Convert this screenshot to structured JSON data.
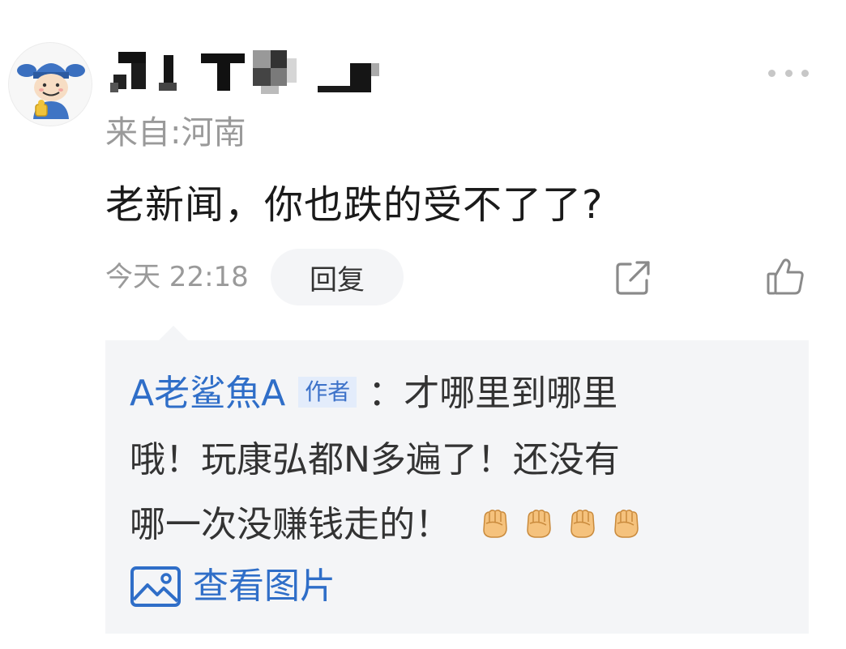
{
  "comment": {
    "location": "来自:河南",
    "text": "老新闻，你也跌的受不了了?",
    "timestamp": "今天 22:18",
    "reply_label": "回复"
  },
  "icons": {
    "avatar": "cartoon-god-of-wealth-avatar",
    "more": "more-dots-icon",
    "share": "share-icon",
    "like": "thumbs-up-icon",
    "fist": "raised-fist-emoji",
    "image": "image-icon"
  },
  "quoted_reply": {
    "author": "A老鲨魚A",
    "author_badge": "作者",
    "text_line1": "：才哪里到哪里",
    "text_line2": "哦！玩康弘都N多遍了！还没有",
    "text_line3": "哪一次没赚钱走的！",
    "fist_count": 4,
    "view_image_label": "查看图片"
  },
  "colors": {
    "link_blue": "#2f6ec8",
    "panel_bg": "#f4f5f7",
    "muted_text": "#9a9a9a"
  }
}
